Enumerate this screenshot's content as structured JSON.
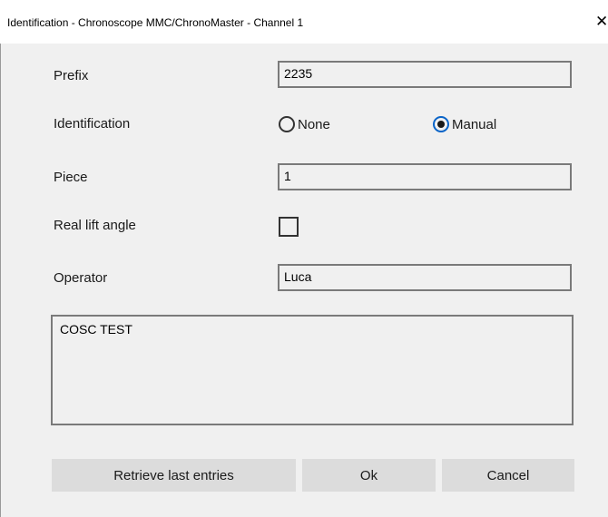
{
  "window": {
    "title": "Identification - Chronoscope MMC/ChronoMaster - Channel 1",
    "close_glyph": "✕"
  },
  "form": {
    "prefix": {
      "label": "Prefix",
      "value": "2235"
    },
    "identification": {
      "label": "Identification",
      "options": [
        {
          "label": "None",
          "selected": false
        },
        {
          "label": "Manual",
          "selected": true
        }
      ]
    },
    "piece": {
      "label": "Piece",
      "value": "1"
    },
    "real_lift_angle": {
      "label": "Real lift angle",
      "checked": false
    },
    "operator": {
      "label": "Operator",
      "value": "Luca"
    },
    "comment": {
      "value": "COSC TEST"
    }
  },
  "buttons": {
    "retrieve": "Retrieve last entries",
    "ok": "Ok",
    "cancel": "Cancel"
  },
  "colors": {
    "background": "#f0f0f0",
    "radio_selected_ring": "#0a64c8",
    "button_face": "#dcdcdc"
  }
}
